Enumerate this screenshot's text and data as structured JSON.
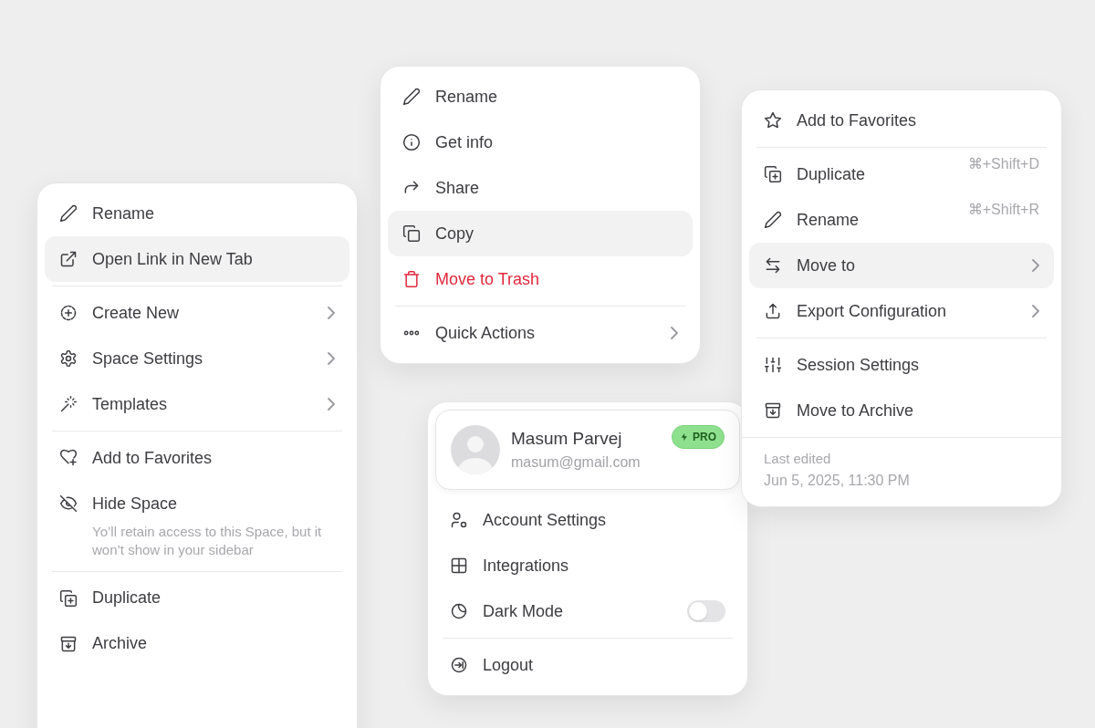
{
  "menus": [
    {
      "kind": "menu",
      "groups": [
        {
          "items": [
            {
              "label": "Rename",
              "kind": "action",
              "selected": false,
              "submenu": false
            },
            {
              "label": "Open Link in New Tab",
              "kind": "action",
              "selected": true,
              "submenu": false
            }
          ]
        },
        {
          "items": [
            {
              "label": "Create New",
              "kind": "action",
              "selected": false,
              "submenu": true
            },
            {
              "label": "Space Settings",
              "kind": "action",
              "selected": false,
              "submenu": true
            },
            {
              "label": "Templates",
              "kind": "action",
              "selected": false,
              "submenu": true
            }
          ]
        },
        {
          "items": [
            {
              "label": "Add to Favorites",
              "kind": "action",
              "selected": false,
              "submenu": false
            },
            {
              "label": "Hide Space",
              "kind": "action",
              "selected": false,
              "submenu": false,
              "description": "Yo’ll retain access to this Space, but it won’t show in your sidebar"
            }
          ]
        },
        {
          "items": [
            {
              "label": "Duplicate",
              "kind": "action",
              "selected": false,
              "submenu": false
            },
            {
              "label": "Archive",
              "kind": "action",
              "selected": false,
              "submenu": false
            }
          ]
        }
      ]
    },
    {
      "kind": "menu",
      "groups": [
        {
          "items": [
            {
              "label": "Rename",
              "kind": "action",
              "selected": false,
              "submenu": false
            },
            {
              "label": "Get info",
              "kind": "action",
              "selected": false,
              "submenu": false
            },
            {
              "label": "Share",
              "kind": "action",
              "selected": false,
              "submenu": false
            },
            {
              "label": "Copy",
              "kind": "action",
              "selected": true,
              "submenu": false
            },
            {
              "label": "Move to Trash",
              "kind": "danger",
              "selected": false,
              "submenu": false
            }
          ]
        },
        {
          "items": [
            {
              "label": "Quick Actions",
              "kind": "action",
              "selected": false,
              "submenu": true
            }
          ]
        }
      ]
    },
    {
      "kind": "profile",
      "profile": {
        "name": "Masum Parvej",
        "email": "masum@gmail.com",
        "badge": "PRO"
      },
      "groups": [
        {
          "items": [
            {
              "label": "Account Settings",
              "kind": "action",
              "selected": false,
              "submenu": false
            },
            {
              "label": "Integrations",
              "kind": "action",
              "selected": false,
              "submenu": false
            },
            {
              "label": "Dark Mode",
              "kind": "toggle",
              "selected": false,
              "submenu": false,
              "on": false
            }
          ]
        },
        {
          "items": [
            {
              "label": "Logout",
              "kind": "action",
              "selected": false,
              "submenu": false
            }
          ]
        }
      ]
    },
    {
      "kind": "menu",
      "groups": [
        {
          "items": [
            {
              "label": "Add to Favorites",
              "kind": "action",
              "selected": false,
              "submenu": false
            }
          ]
        },
        {
          "items": [
            {
              "label": "Duplicate",
              "kind": "action",
              "selected": false,
              "submenu": false,
              "shortcut": "⌘+Shift+D"
            },
            {
              "label": "Rename",
              "kind": "action",
              "selected": false,
              "submenu": false,
              "shortcut": "⌘+Shift+R"
            },
            {
              "label": "Move to",
              "kind": "action",
              "selected": true,
              "submenu": true
            },
            {
              "label": "Export Configuration",
              "kind": "action",
              "selected": false,
              "submenu": true
            }
          ]
        },
        {
          "items": [
            {
              "label": "Session Settings",
              "kind": "action",
              "selected": false,
              "submenu": false
            },
            {
              "label": "Move to Archive",
              "kind": "action",
              "selected": false,
              "submenu": false
            }
          ]
        }
      ],
      "footer": {
        "label": "Last edited",
        "timestamp": "Jun 5, 2025, 11:30 PM"
      }
    }
  ]
}
